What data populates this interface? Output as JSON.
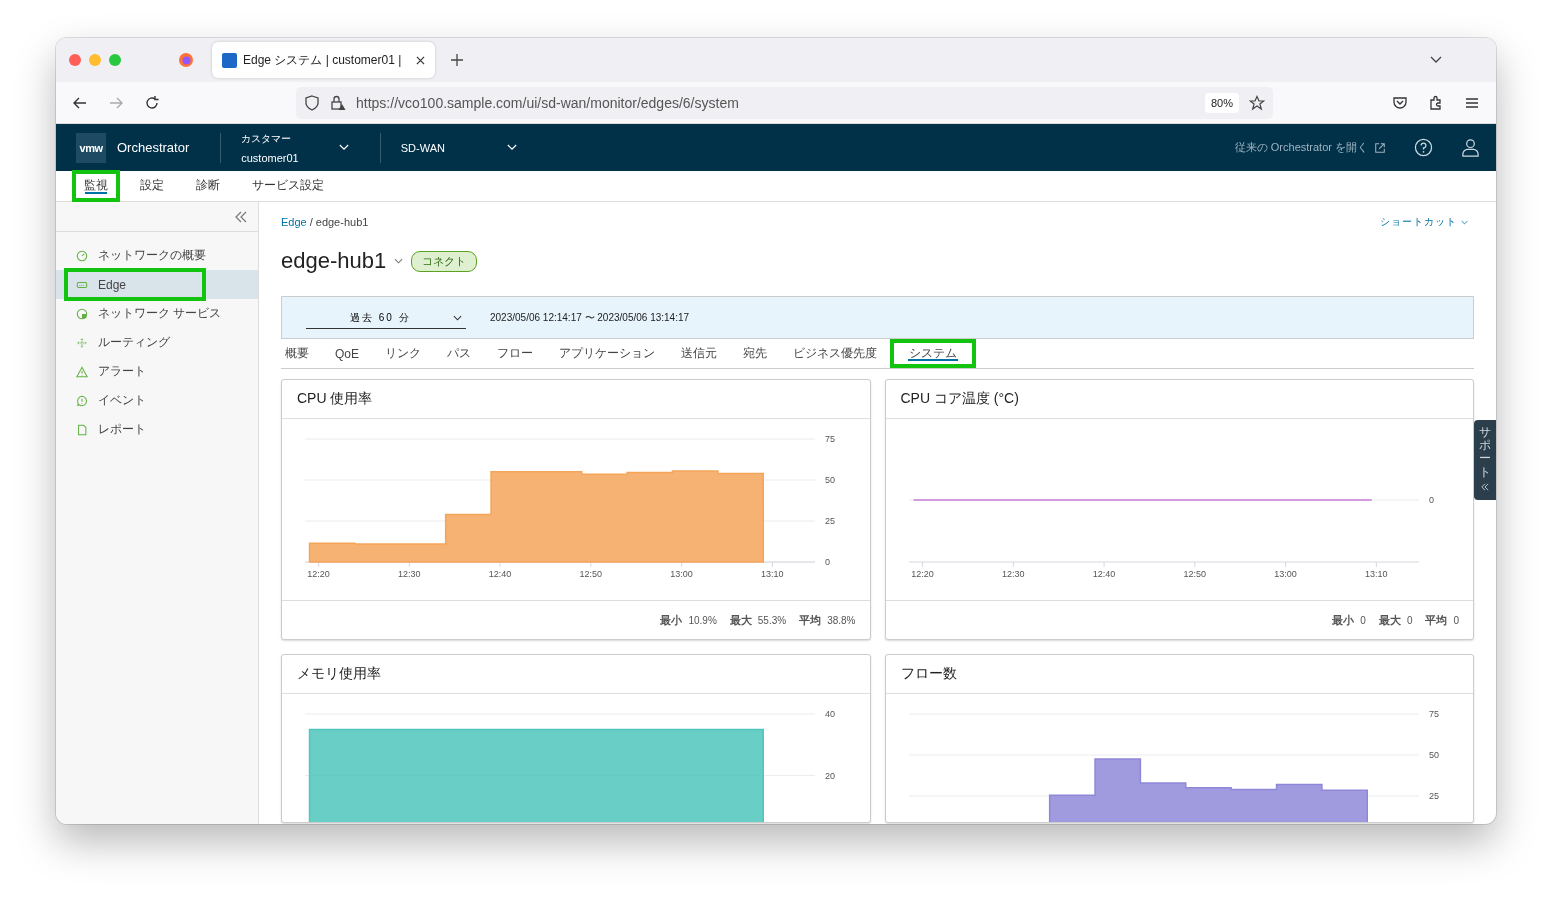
{
  "browser": {
    "tab_title": "Edge システム | customer01 |",
    "url": "https://vco100.sample.com/ui/sd-wan/monitor/edges/6/system",
    "zoom": "80%"
  },
  "header": {
    "logo": "vmw",
    "product": "Orchestrator",
    "customer_label": "カスタマー",
    "customer": "customer01",
    "network": "SD-WAN",
    "legacy_link": "従来の Orchestrator を開く"
  },
  "top_nav": [
    {
      "label": "監視",
      "selected": true,
      "highlighted": true
    },
    {
      "label": "設定",
      "selected": false,
      "highlighted": false
    },
    {
      "label": "診断",
      "selected": false,
      "highlighted": false
    },
    {
      "label": "サービス設定",
      "selected": false,
      "highlighted": false
    }
  ],
  "sidebar": {
    "items": [
      {
        "label": "ネットワークの概要",
        "selected": false,
        "highlighted": false
      },
      {
        "label": "Edge",
        "selected": true,
        "highlighted": true
      },
      {
        "label": "ネットワーク サービス",
        "selected": false,
        "highlighted": false
      },
      {
        "label": "ルーティング",
        "selected": false,
        "highlighted": false
      },
      {
        "label": "アラート",
        "selected": false,
        "highlighted": false
      },
      {
        "label": "イベント",
        "selected": false,
        "highlighted": false
      },
      {
        "label": "レポート",
        "selected": false,
        "highlighted": false
      }
    ]
  },
  "breadcrumb": {
    "link": "Edge",
    "separator": "/",
    "current": "edge-hub1"
  },
  "shortcut": "ショートカット",
  "title": "edge-hub1",
  "status_badge": "コネクト",
  "filter": {
    "range": "過去 60 分",
    "dates": "2023/05/06 12:14:17 〜 2023/05/06 13:14:17"
  },
  "tabs": [
    {
      "label": "概要",
      "selected": false,
      "highlighted": false
    },
    {
      "label": "QoE",
      "selected": false,
      "highlighted": false
    },
    {
      "label": "リンク",
      "selected": false,
      "highlighted": false
    },
    {
      "label": "パス",
      "selected": false,
      "highlighted": false
    },
    {
      "label": "フロー",
      "selected": false,
      "highlighted": false
    },
    {
      "label": "アプリケーション",
      "selected": false,
      "highlighted": false
    },
    {
      "label": "送信元",
      "selected": false,
      "highlighted": false
    },
    {
      "label": "宛先",
      "selected": false,
      "highlighted": false
    },
    {
      "label": "ビジネス優先度",
      "selected": false,
      "highlighted": false
    },
    {
      "label": "システム",
      "selected": true,
      "highlighted": true
    }
  ],
  "cards": [
    {
      "title": "CPU 使用率",
      "chart_data": {
        "type": "area",
        "ylim": [
          0,
          75
        ],
        "yticks": [
          0,
          25,
          50,
          75
        ],
        "categories": [
          "12:20",
          null,
          "12:30",
          null,
          "12:40",
          null,
          "12:50",
          null,
          "13:00",
          null,
          "13:10"
        ],
        "series": [
          {
            "color": "#f5a55a",
            "values": [
              11.5,
              11,
              11,
              29,
              55,
              55,
              53.5,
              54.5,
              55.5,
              54,
              54
            ]
          }
        ]
      },
      "stats": [
        {
          "label": "最小",
          "value": "10.9%"
        },
        {
          "label": "最大",
          "value": "55.3%"
        },
        {
          "label": "平均",
          "value": "38.8%"
        }
      ]
    },
    {
      "title": "CPU コア温度 (°C)",
      "kind": "picture",
      "y_label": "0",
      "x_labels": [
        "12:20",
        "12:30",
        "12:40",
        "12:50",
        "13:00",
        "13:10"
      ],
      "stats": [
        {
          "label": "最小",
          "value": "0"
        },
        {
          "label": "最大",
          "value": "0"
        },
        {
          "label": "平均",
          "value": "0"
        }
      ]
    },
    {
      "title": "メモリ使用率",
      "chart_data": {
        "type": "area",
        "ylim": [
          0,
          40
        ],
        "yticks": [
          20,
          40
        ],
        "categories": [
          null,
          null,
          null,
          null,
          null,
          null,
          null,
          null,
          null,
          null,
          null
        ],
        "series": [
          {
            "color": "#4fc5bb",
            "values": [
              35,
              35,
              35,
              35,
              35,
              35,
              35,
              35,
              35,
              35,
              35
            ]
          }
        ]
      }
    },
    {
      "title": "フロー数",
      "chart_data": {
        "type": "area",
        "ylim": [
          0,
          75
        ],
        "yticks": [
          25,
          50,
          75
        ],
        "categories": [
          null,
          null,
          null,
          null,
          null,
          null,
          null,
          null,
          null,
          null
        ],
        "series": [
          {
            "color": "#8f88d8",
            "values": [
              8,
              8,
              25.5,
              47.5,
              33,
              30,
              29,
              32,
              28.5,
              28.5
            ]
          }
        ]
      }
    }
  ],
  "support_tab": "サポート"
}
